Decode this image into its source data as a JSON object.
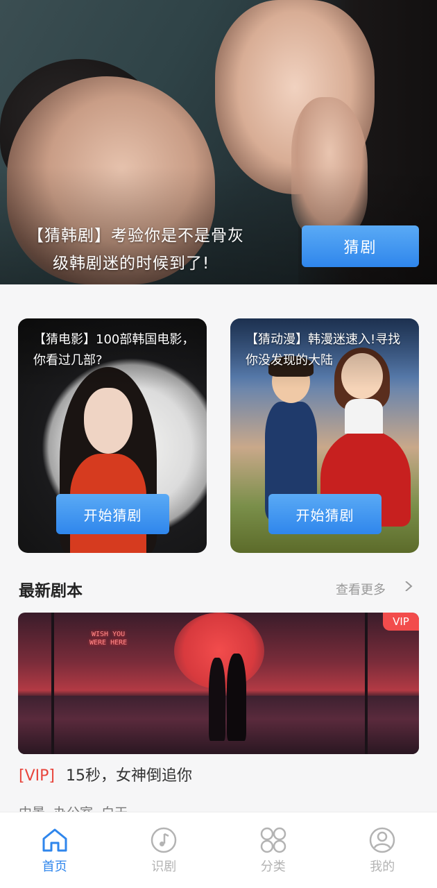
{
  "hero": {
    "line1": "【猜韩剧】考验你是不是骨灰",
    "line2": "级韩剧迷的时候到了!",
    "button": "猜剧"
  },
  "cards": [
    {
      "title": "【猜电影】100部韩国电影，你看过几部?",
      "button": "开始猜剧"
    },
    {
      "title": "【猜动漫】韩漫迷速入!寻找你没发现的大陆",
      "button": "开始猜剧"
    }
  ],
  "latest": {
    "title": "最新剧本",
    "more": "查看更多",
    "item": {
      "badge": "VIP",
      "sign_line1": "WISH YOU",
      "sign_line2": "WERE HERE",
      "vip_tag": "[VIP]",
      "title": "15秒，女神倒追你",
      "tags": "中景 办公室 白天"
    }
  },
  "tabbar": {
    "items": [
      {
        "label": "首页",
        "icon": "home-icon",
        "active": true
      },
      {
        "label": "识剧",
        "icon": "music-note-icon",
        "active": false
      },
      {
        "label": "分类",
        "icon": "category-grid-icon",
        "active": false
      },
      {
        "label": "我的",
        "icon": "user-icon",
        "active": false
      }
    ]
  },
  "colors": {
    "accent": "#2f86ec",
    "vip_red": "#e8453c",
    "inactive": "#b3b3b3"
  }
}
